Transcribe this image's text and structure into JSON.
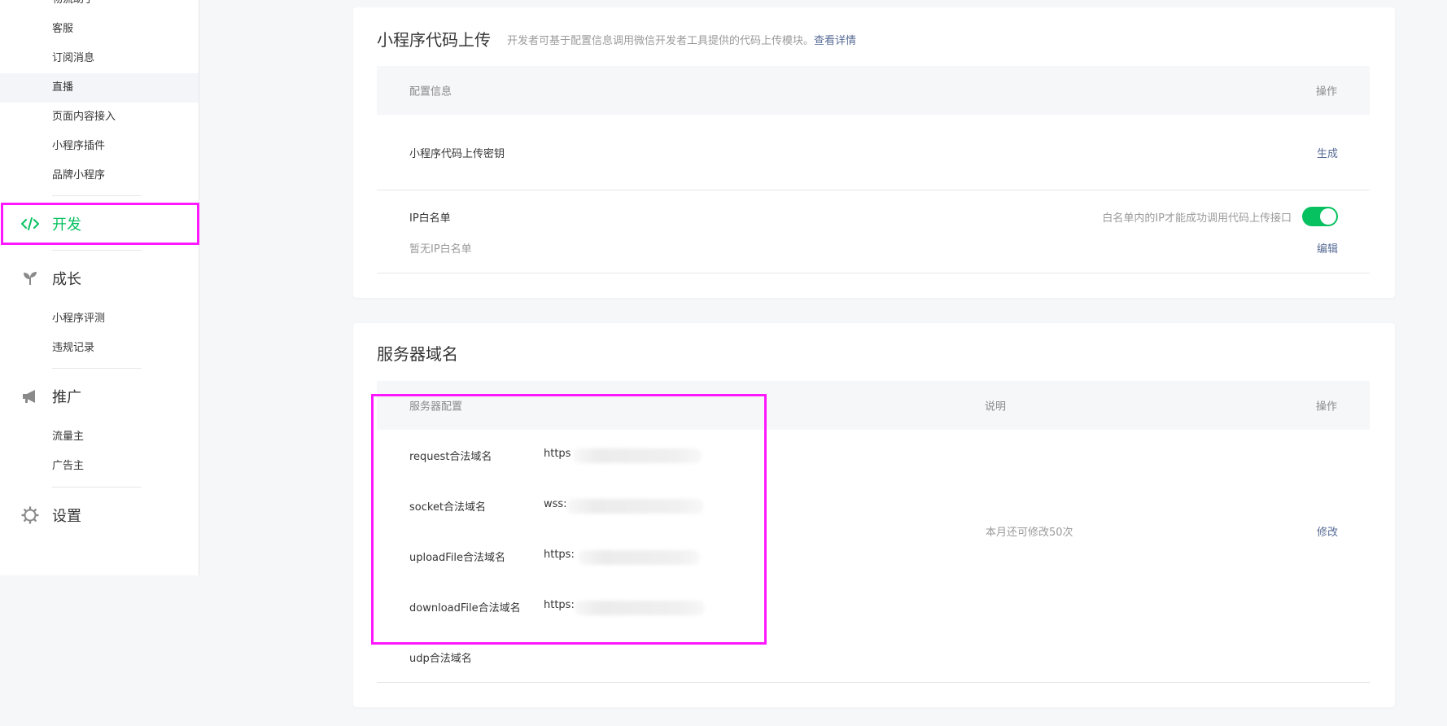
{
  "sidebar": {
    "top_items": [
      {
        "label": "物流助手"
      },
      {
        "label": "客服"
      },
      {
        "label": "订阅消息"
      },
      {
        "label": "直播"
      },
      {
        "label": "页面内容接入"
      },
      {
        "label": "小程序插件"
      },
      {
        "label": "品牌小程序"
      }
    ],
    "groups": {
      "dev": {
        "label": "开发",
        "icon": "code-icon",
        "color": "#07c160"
      },
      "growth": {
        "label": "成长",
        "icon": "sprout-icon",
        "items": [
          {
            "label": "小程序评测"
          },
          {
            "label": "违规记录"
          }
        ]
      },
      "promo": {
        "label": "推广",
        "icon": "megaphone-icon",
        "items": [
          {
            "label": "流量主"
          },
          {
            "label": "广告主"
          }
        ]
      },
      "settings": {
        "label": "设置",
        "icon": "gear-icon"
      }
    }
  },
  "upload_card": {
    "title": "小程序代码上传",
    "desc": "开发者可基于配置信息调用微信开发者工具提供的代码上传模块。",
    "desc_link": "查看详情",
    "header": {
      "col1": "配置信息",
      "col2": "操作"
    },
    "key_row": {
      "label": "小程序代码上传密钥",
      "action": "生成"
    },
    "ip_row": {
      "label": "IP白名单",
      "empty": "暂无IP白名单",
      "toggle_hint": "白名单内的IP才能成功调用代码上传接口",
      "toggle_on": true,
      "action": "编辑"
    }
  },
  "server_card": {
    "title": "服务器域名",
    "header": {
      "col1": "服务器配置",
      "col2": "说明",
      "col3": "操作"
    },
    "rows": [
      {
        "label": "request合法域名",
        "value": "https"
      },
      {
        "label": "socket合法域名",
        "value": "wss:"
      },
      {
        "label": "uploadFile合法域名",
        "value": "https:"
      },
      {
        "label": "downloadFile合法域名",
        "value": "https:"
      },
      {
        "label": "udp合法域名",
        "value": ""
      }
    ],
    "note": "本月还可修改50次",
    "action": "修改"
  },
  "colors": {
    "accent": "#07c160",
    "link": "#576b95",
    "highlight": "#ff17ff"
  }
}
